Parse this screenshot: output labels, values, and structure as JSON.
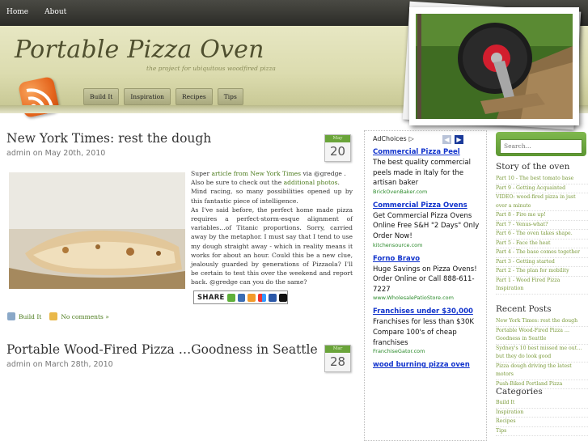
{
  "topnav": [
    "Home",
    "About"
  ],
  "header": {
    "title": "Portable Pizza Oven",
    "tagline": "the project for ubiquitous woodfired pizza",
    "categories": [
      "Build It",
      "Inspiration",
      "Recipes",
      "Tips"
    ]
  },
  "posts": [
    {
      "title": "New York Times: rest the dough",
      "meta": "admin on May 20th, 2010",
      "date_month": "May",
      "date_day": "20",
      "body": {
        "p1_pre": "Super ",
        "p1_link": "article from New York Times",
        "p1_post": " via @gredge .",
        "p2_pre": "Also be sure to check out the ",
        "p2_link": "additional photos",
        "p2_post": ".",
        "p3": "Mind racing, so many possibilities opened up by this fantastic piece of intelligence.",
        "p4": "As I've said before, the perfect home made pizza requires a perfect-storm-esque alignment of variables…of Titanic proportions. Sorry, carried away by the metaphor. I must say that I tend to use my dough straight away - which in reality means it works for about an hour. Could this be a new clue, jealously guarded by generations of Pizzaola? I'll be certain to test this over the weekend and report back. @gredge can you do the same?"
      },
      "share_label": "SHARE",
      "category_link": "Build It",
      "comments_link": "No comments »"
    },
    {
      "title": "Portable Wood-Fired Pizza …Goodness in Seattle",
      "meta": "admin on March 28th, 2010",
      "date_month": "Mar",
      "date_day": "28"
    }
  ],
  "ads": {
    "adchoices": "AdChoices",
    "items": [
      {
        "title": "Commercial Pizza Peel",
        "body": "The best quality commercial peels made in Italy for the artisan baker",
        "url": "BrickOvenBaker.com"
      },
      {
        "title": "Commercial Pizza Ovens",
        "body": "Get Commercial Pizza Ovens Online Free S&H \"2 Days\" Only Order Now!",
        "url": "kitchensource.com"
      },
      {
        "title": "Forno Bravo",
        "body": "Huge Savings on Pizza Ovens! Order Online or Call 888-611-7227",
        "url": "www.WholesalePatioStore.com"
      },
      {
        "title": "Franchises under $30,000",
        "body": "Franchises for less than $30K Compare 100's of cheap franchises",
        "url": "FranchiseGator.com"
      },
      {
        "title": "wood burning pizza oven",
        "body": "",
        "url": ""
      }
    ]
  },
  "sidebar": {
    "search_placeholder": "Search...",
    "story_title": "Story of the oven",
    "story_items": [
      "Part 10 - The best tomato base",
      "Part 9 - Getting Acquainted",
      "VIDEO: wood-fired pizza in just over a minute",
      "Part 8 - Fire me up!",
      "Part 7 - Venus-what?",
      "Part 6 - The oven takes shape.",
      "Part 5 - Face the heat",
      "Part 4 - The base comes together",
      "Part 3 - Getting started",
      "Part 2 - The plan for mobility",
      "Part 1 - Wood Fired Pizza Inspiration"
    ],
    "recent_title": "Recent Posts",
    "recent_items": [
      "New York Times: rest the dough",
      "Portable Wood-Fired Pizza …Goodness in Seattle",
      "Sydney's 10 best missed me out… but they do look good",
      "Pizza dough driving the latest motors",
      "Push-Biked Portland Pizza"
    ],
    "categories_title": "Categories",
    "category_items": [
      "Build It",
      "Inspiration",
      "Recipes",
      "Tips"
    ]
  },
  "colors": {
    "accent_green": "#6aa43a",
    "link_blue": "#1133cc",
    "rss_orange": "#e4641c"
  }
}
